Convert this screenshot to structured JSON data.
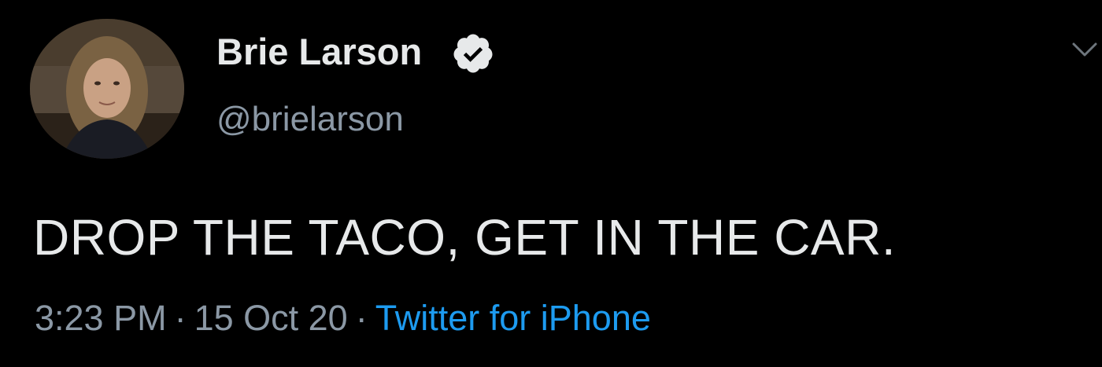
{
  "tweet": {
    "author": {
      "display_name": "Brie Larson",
      "handle": "@brielarson",
      "verified": true
    },
    "text": "DROP THE TACO, GET IN THE CAR.",
    "meta": {
      "time": "3:23 PM",
      "separator": "·",
      "date": "15 Oct 20",
      "source": "Twitter for iPhone"
    }
  },
  "icons": {
    "verified": "verified-badge-icon",
    "menu": "chevron-down-icon"
  },
  "colors": {
    "background": "#000000",
    "primary_text": "#e7e9ea",
    "secondary_text": "#8b98a5",
    "link": "#1d9bf0"
  }
}
